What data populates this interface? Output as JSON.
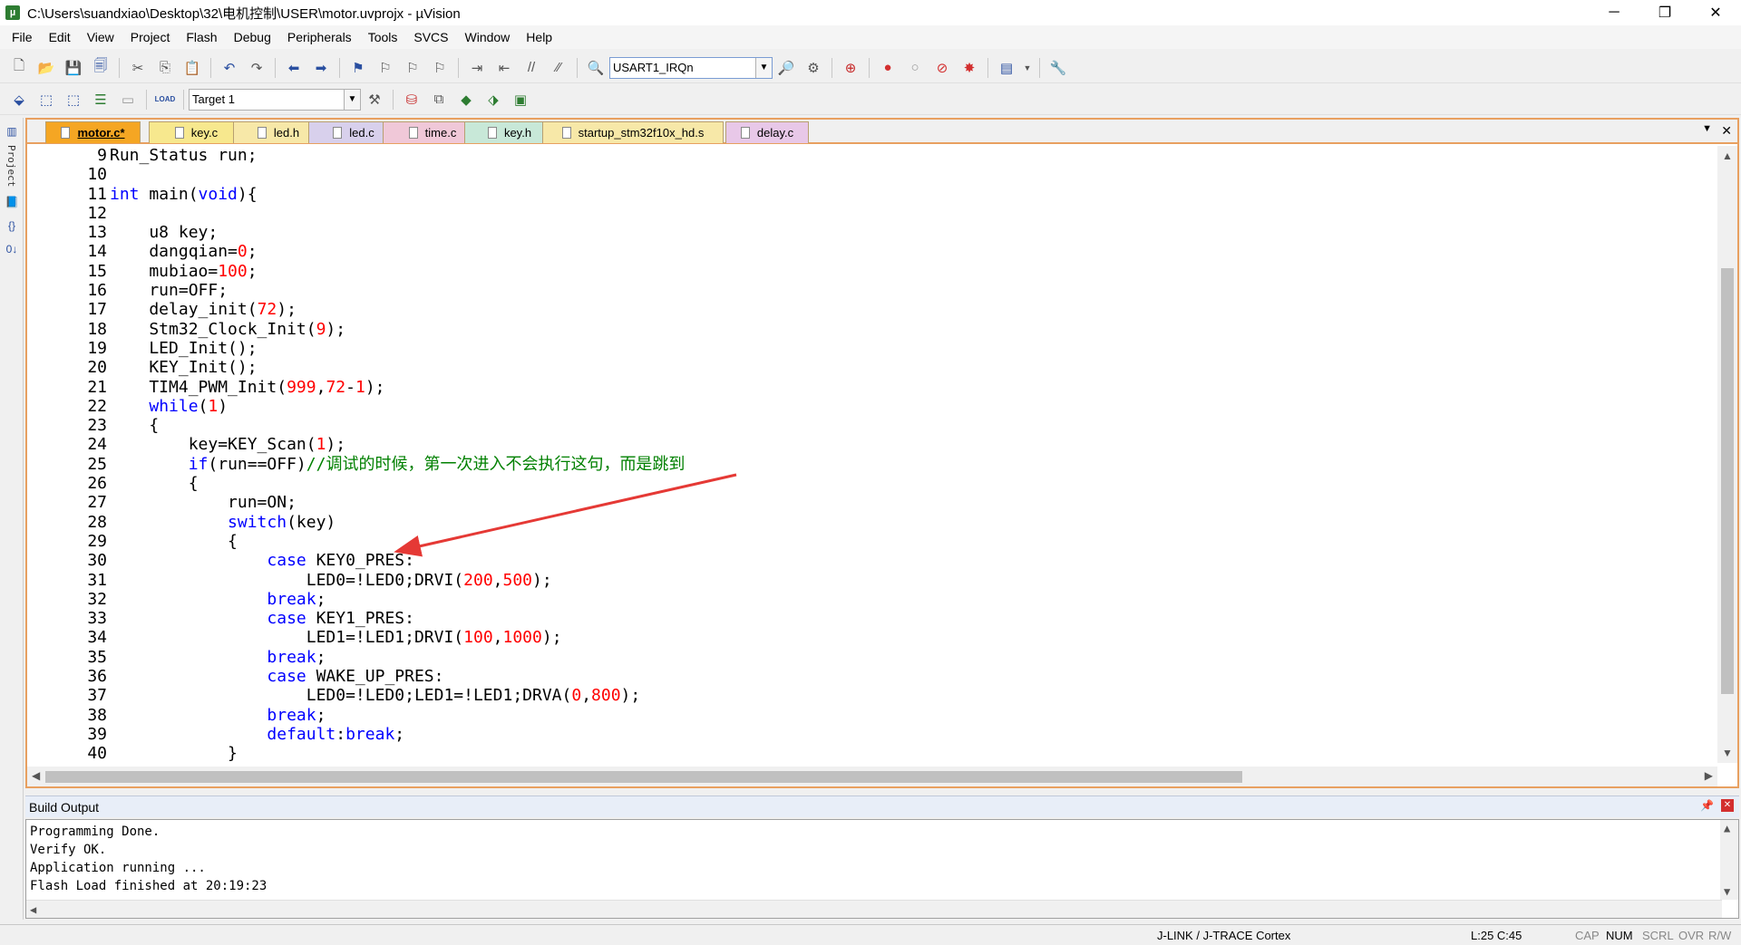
{
  "window": {
    "title": "C:\\Users\\suandxiao\\Desktop\\32\\电机控制\\USER\\motor.uvprojx - µVision",
    "app_icon": "uvision-icon",
    "minimize": "─",
    "maximize": "❐",
    "close": "✕"
  },
  "menu": [
    "File",
    "Edit",
    "View",
    "Project",
    "Flash",
    "Debug",
    "Peripherals",
    "Tools",
    "SVCS",
    "Window",
    "Help"
  ],
  "toolbar1": {
    "find_combo_value": "USART1_IRQn"
  },
  "toolbar2": {
    "target_combo_value": "Target 1",
    "load_label": "LOAD"
  },
  "sidebar": {
    "project_label": "Project"
  },
  "tabs": [
    {
      "label": "motor.c*",
      "active": true,
      "color": "#f5a623"
    },
    {
      "label": "key.c",
      "active": false,
      "color": "#f7e88e"
    },
    {
      "label": "led.h",
      "active": false,
      "color": "#f7e8a8"
    },
    {
      "label": "led.c",
      "active": false,
      "color": "#d8d0ec"
    },
    {
      "label": "time.c",
      "active": false,
      "color": "#f0c8d8"
    },
    {
      "label": "key.h",
      "active": false,
      "color": "#c8e8d8"
    },
    {
      "label": "startup_stm32f10x_hd.s",
      "active": false,
      "color": "#f7e8a8"
    },
    {
      "label": "delay.c",
      "active": false,
      "color": "#e8c8e8"
    }
  ],
  "code": [
    {
      "n": "9",
      "html": "Run_Status run;"
    },
    {
      "n": "10",
      "html": ""
    },
    {
      "n": "11",
      "html": "<span class=\"kw\">int</span> main(<span class=\"kw\">void</span>){"
    },
    {
      "n": "12",
      "html": ""
    },
    {
      "n": "13",
      "html": "    u8 key;"
    },
    {
      "n": "14",
      "html": "    dangqian=<span class=\"num\">0</span>;"
    },
    {
      "n": "15",
      "html": "    mubiao=<span class=\"num\">100</span>;"
    },
    {
      "n": "16",
      "html": "    run=OFF;"
    },
    {
      "n": "17",
      "html": "    delay_init(<span class=\"num\">72</span>);"
    },
    {
      "n": "18",
      "html": "    Stm32_Clock_Init(<span class=\"num\">9</span>);"
    },
    {
      "n": "19",
      "html": "    LED_Init();"
    },
    {
      "n": "20",
      "html": "    KEY_Init();"
    },
    {
      "n": "21",
      "html": "    TIM4_PWM_Init(<span class=\"num\">999</span>,<span class=\"num\">72</span>-<span class=\"num\">1</span>);"
    },
    {
      "n": "22",
      "html": "    <span class=\"kw\">while</span>(<span class=\"num\">1</span>)"
    },
    {
      "n": "23",
      "html": "    {"
    },
    {
      "n": "24",
      "html": "        key=KEY_Scan(<span class=\"num\">1</span>);"
    },
    {
      "n": "25",
      "html": "        <span class=\"kw\">if</span>(run==OFF)<span class=\"cm\">//调试的时候，第一次进入不会执行这句，而是跳到</span>"
    },
    {
      "n": "26",
      "html": "        {"
    },
    {
      "n": "27",
      "html": "            run=ON;"
    },
    {
      "n": "28",
      "html": "            <span class=\"kw\">switch</span>(key)"
    },
    {
      "n": "29",
      "html": "            {"
    },
    {
      "n": "30",
      "html": "                <span class=\"kw\">case</span> KEY0_PRES:"
    },
    {
      "n": "31",
      "html": "                    LED0=!LED0;DRVI(<span class=\"num\">200</span>,<span class=\"num\">500</span>);"
    },
    {
      "n": "32",
      "html": "                <span class=\"kw\">break</span>;"
    },
    {
      "n": "33",
      "html": "                <span class=\"kw\">case</span> KEY1_PRES:"
    },
    {
      "n": "34",
      "html": "                    LED1=!LED1;DRVI(<span class=\"num\">100</span>,<span class=\"num\">1000</span>);"
    },
    {
      "n": "35",
      "html": "                <span class=\"kw\">break</span>;"
    },
    {
      "n": "36",
      "html": "                <span class=\"kw\">case</span> WAKE_UP_PRES:"
    },
    {
      "n": "37",
      "html": "                    LED0=!LED0;LED1=!LED1;DRVA(<span class=\"num\">0</span>,<span class=\"num\">800</span>);"
    },
    {
      "n": "38",
      "html": "                <span class=\"kw\">break</span>;"
    },
    {
      "n": "39",
      "html": "                <span class=\"kw\">default</span>:<span class=\"kw\">break</span>;"
    },
    {
      "n": "40",
      "html": "            }"
    }
  ],
  "build_output": {
    "title": "Build Output",
    "lines": [
      "Programming Done.",
      "Verify OK.",
      "Application running ...",
      "Flash Load finished at 20:19:23"
    ]
  },
  "status": {
    "debugger": "J-LINK / J-TRACE Cortex",
    "position": "L:25 C:45",
    "cap": "CAP",
    "num": "NUM",
    "scrl": "SCRL",
    "ovr": "OVR",
    "rw": "R/W"
  },
  "colors": {
    "keyword": "#0000ff",
    "number": "#ff0000",
    "comment": "#008000",
    "annotation_arrow": "#e53935",
    "editor_border": "#e8a060"
  }
}
